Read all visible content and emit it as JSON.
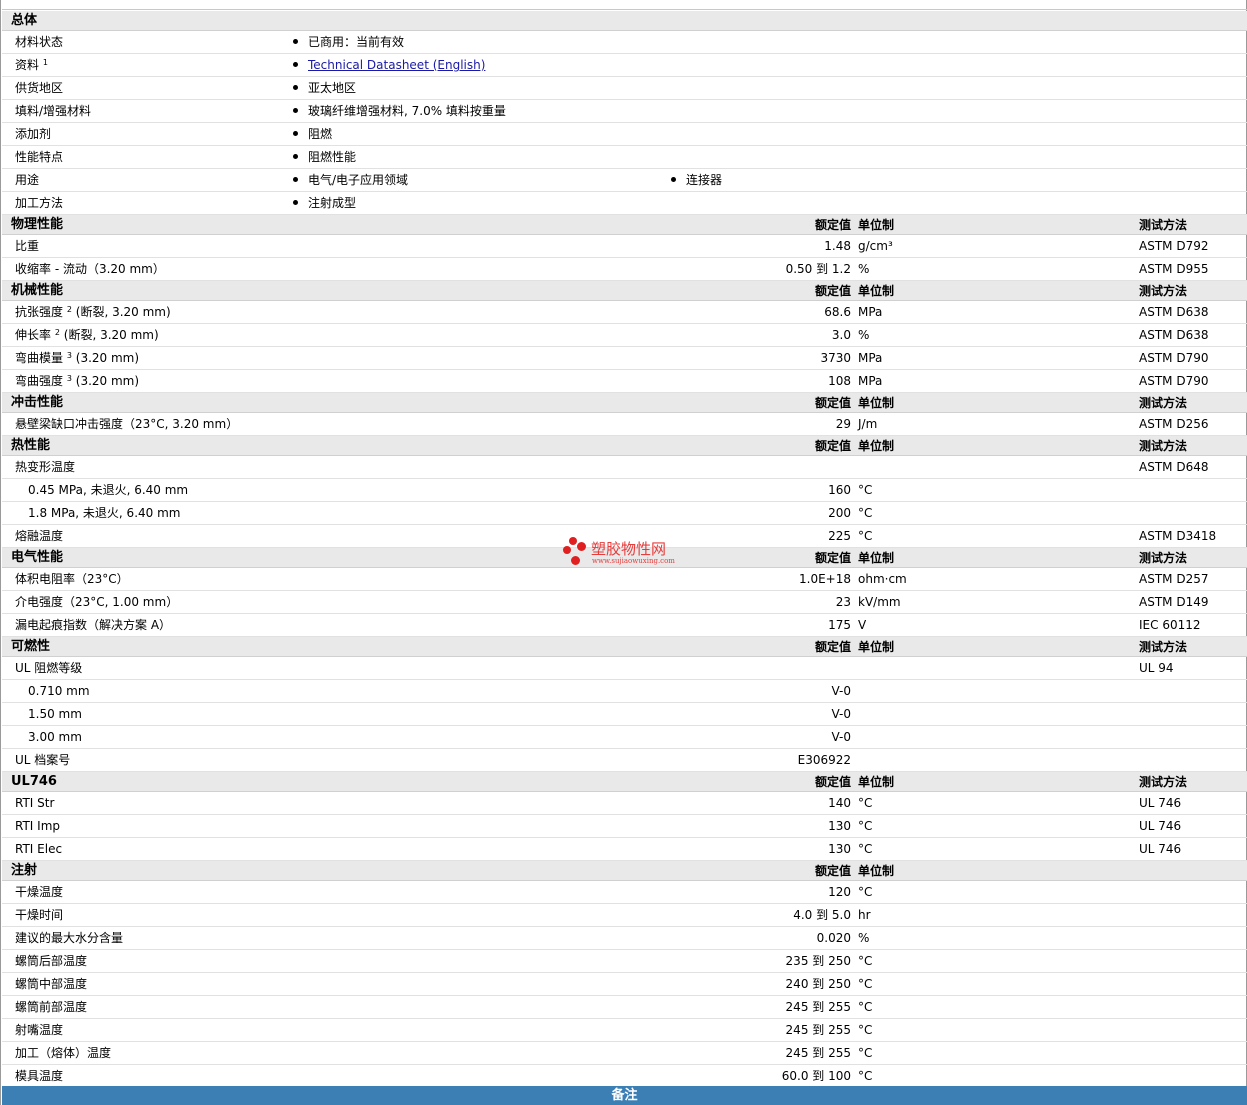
{
  "general": {
    "title": "总体",
    "rows": [
      {
        "label": "材料状态",
        "col1": "已商用：当前有效"
      },
      {
        "label": "资料",
        "sup": "1",
        "col1": "Technical Datasheet (English)",
        "link": true
      },
      {
        "label": "供货地区",
        "col1": "亚太地区"
      },
      {
        "label": "填料/增强材料",
        "col1": "玻璃纤维增强材料, 7.0% 填料按重量"
      },
      {
        "label": "添加剂",
        "col1": "阻燃"
      },
      {
        "label": "性能特点",
        "col1": "阻燃性能"
      },
      {
        "label": "用途",
        "col1": "电气/电子应用领域",
        "col2": "连接器"
      },
      {
        "label": "加工方法",
        "col1": "注射成型"
      }
    ]
  },
  "headers": {
    "value": "额定值",
    "unit": "单位制",
    "test": "测试方法"
  },
  "sections": [
    {
      "title": "物理性能",
      "test_col": true,
      "rows": [
        {
          "label": "比重",
          "value": "1.48",
          "unit": "g/cm³",
          "test": "ASTM D792"
        },
        {
          "label": "收缩率  - 流动（3.20 mm）",
          "value": "0.50 到  1.2",
          "unit": "%",
          "test": "ASTM D955"
        }
      ]
    },
    {
      "title": "机械性能",
      "test_col": true,
      "rows": [
        {
          "label": "抗张强度",
          "sup": "2",
          "label2": "(断裂, 3.20 mm)",
          "value": "68.6",
          "unit": "MPa",
          "test": "ASTM D638"
        },
        {
          "label": "伸长率",
          "sup": "2",
          "label2": "(断裂, 3.20 mm)",
          "value": "3.0",
          "unit": "%",
          "test": "ASTM D638"
        },
        {
          "label": "弯曲模量",
          "sup": "3",
          "label2": "(3.20 mm)",
          "value": "3730",
          "unit": "MPa",
          "test": "ASTM D790"
        },
        {
          "label": "弯曲强度",
          "sup": "3",
          "label2": "(3.20 mm)",
          "value": "108",
          "unit": "MPa",
          "test": "ASTM D790"
        }
      ]
    },
    {
      "title": "冲击性能",
      "test_col": true,
      "rows": [
        {
          "label": "悬壁梁缺口冲击强度（23°C, 3.20 mm）",
          "value": "29",
          "unit": "J/m",
          "test": "ASTM D256"
        }
      ]
    },
    {
      "title": "热性能",
      "test_col": true,
      "rows": [
        {
          "label": "热变形温度",
          "value": "",
          "unit": "",
          "test": "ASTM D648"
        },
        {
          "label": "0.45 MPa, 未退火, 6.40 mm",
          "indent": true,
          "value": "160",
          "unit": "°C",
          "test": ""
        },
        {
          "label": "1.8 MPa, 未退火, 6.40 mm",
          "indent": true,
          "value": "200",
          "unit": "°C",
          "test": ""
        },
        {
          "label": "熔融温度",
          "value": "225",
          "unit": "°C",
          "test": "ASTM D3418"
        }
      ]
    },
    {
      "title": "电气性能",
      "test_col": true,
      "rows": [
        {
          "label": "体积电阻率（23°C）",
          "value": "1.0E+18",
          "unit": "ohm·cm",
          "test": "ASTM D257"
        },
        {
          "label": "介电强度（23°C, 1.00 mm）",
          "value": "23",
          "unit": "kV/mm",
          "test": "ASTM D149"
        },
        {
          "label": "漏电起痕指数（解决方案  A）",
          "value": "175",
          "unit": "V",
          "test": "IEC 60112"
        }
      ]
    },
    {
      "title": "可燃性",
      "test_col": true,
      "rows": [
        {
          "label": "UL 阻燃等级",
          "value": "",
          "unit": "",
          "test": "UL 94"
        },
        {
          "label": "0.710 mm",
          "indent": true,
          "value": "V-0",
          "unit": "",
          "test": ""
        },
        {
          "label": "1.50 mm",
          "indent": true,
          "value": "V-0",
          "unit": "",
          "test": ""
        },
        {
          "label": "3.00 mm",
          "indent": true,
          "value": "V-0",
          "unit": "",
          "test": ""
        },
        {
          "label": "UL 档案号",
          "value": "E306922",
          "unit": "",
          "test": ""
        }
      ]
    },
    {
      "title": "UL746",
      "test_col": true,
      "rows": [
        {
          "label": "RTI Str",
          "value": "140",
          "unit": "°C",
          "test": "UL 746"
        },
        {
          "label": "RTI Imp",
          "value": "130",
          "unit": "°C",
          "test": "UL 746"
        },
        {
          "label": "RTI Elec",
          "value": "130",
          "unit": "°C",
          "test": "UL 746"
        }
      ]
    },
    {
      "title": "注射",
      "test_col": false,
      "rows": [
        {
          "label": "干燥温度",
          "value": "120",
          "unit": "°C",
          "test": ""
        },
        {
          "label": "干燥时间",
          "value": "4.0 到  5.0",
          "unit": "hr",
          "test": ""
        },
        {
          "label": "建议的最大水分含量",
          "value": "0.020",
          "unit": "%",
          "test": ""
        },
        {
          "label": "螺筒后部温度",
          "value": "235 到  250",
          "unit": "°C",
          "test": ""
        },
        {
          "label": "螺筒中部温度",
          "value": "240 到  250",
          "unit": "°C",
          "test": ""
        },
        {
          "label": "螺筒前部温度",
          "value": "245 到  255",
          "unit": "°C",
          "test": ""
        },
        {
          "label": "射嘴温度",
          "value": "245 到  255",
          "unit": "°C",
          "test": ""
        },
        {
          "label": "加工（熔体）温度",
          "value": "245 到  255",
          "unit": "°C",
          "test": ""
        },
        {
          "label": "模具温度",
          "value": "60.0 到  100",
          "unit": "°C",
          "test": ""
        }
      ]
    }
  ],
  "notes_title": "备注",
  "watermark": {
    "title": "塑胶物性网",
    "url": "www.sujiaowuxing.com"
  },
  "colors": {
    "section_bg": "#e9e9e9",
    "notes_bar": "#3b7fb5",
    "watermark": "#e53c3c"
  }
}
